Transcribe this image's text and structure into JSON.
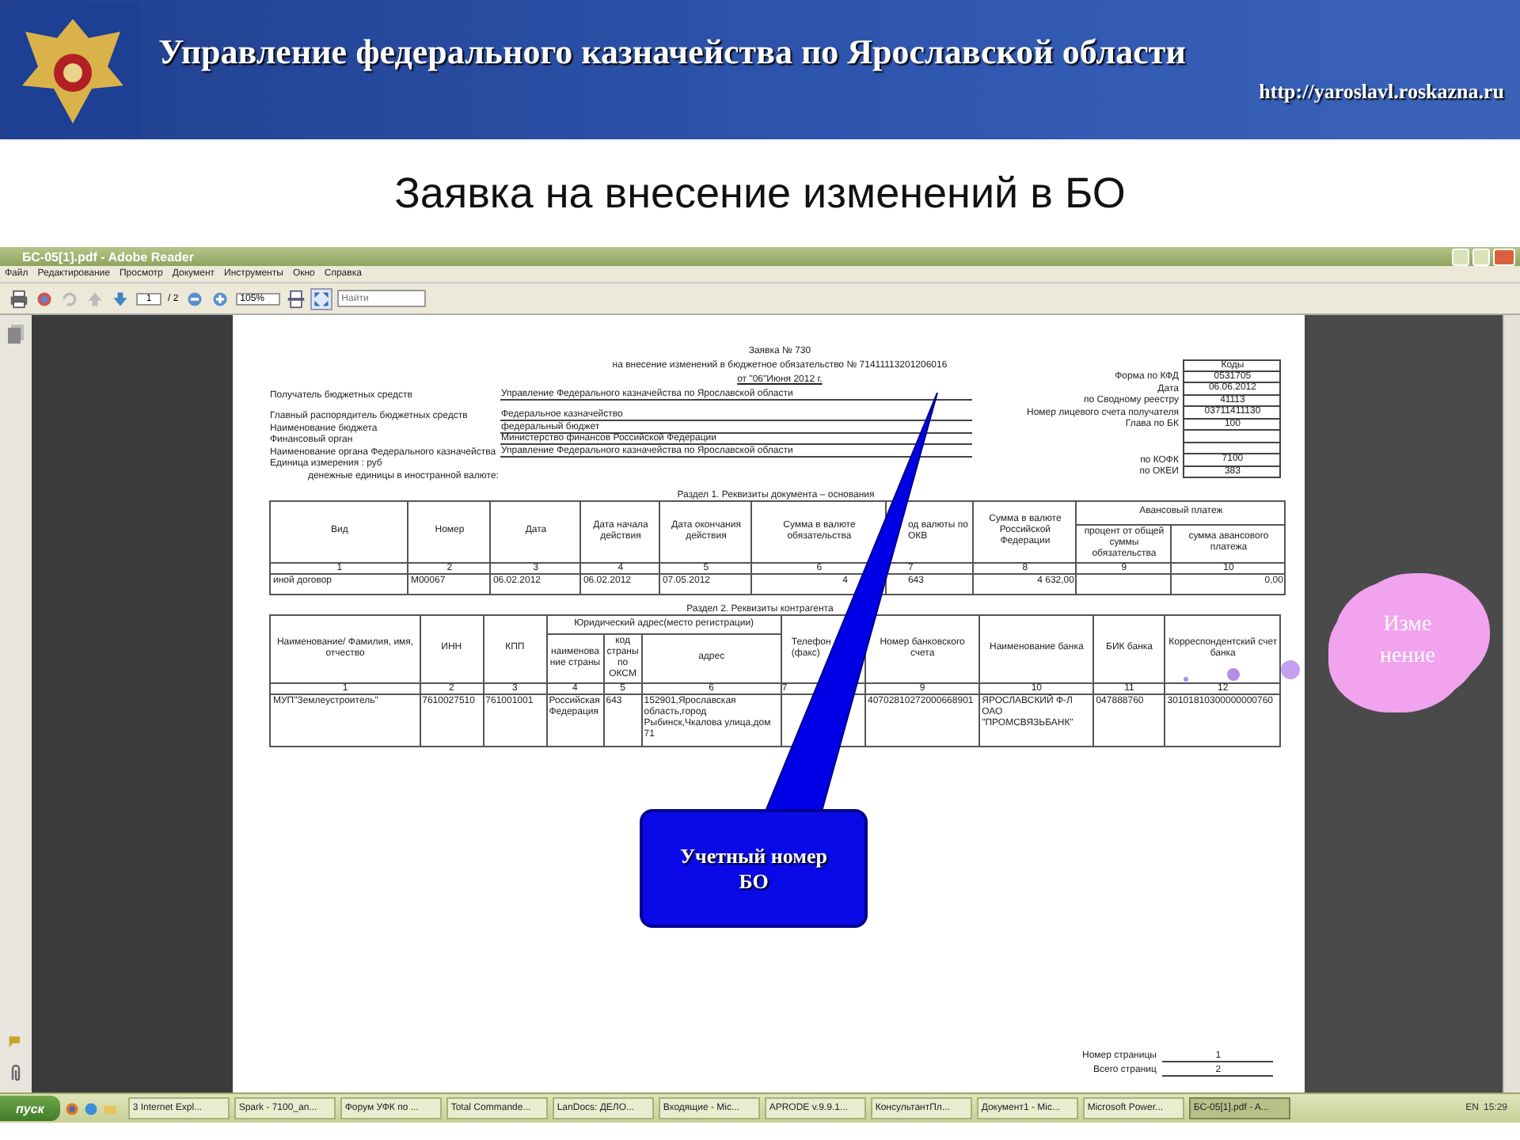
{
  "header": {
    "title": "Управление федерального казначейства по Ярославской области",
    "url": "http://yaroslavl.roskazna.ru"
  },
  "slide_title": "Заявка на внесение изменений в БО",
  "window": {
    "title": "БС-05[1].pdf - Adobe Reader",
    "menu": [
      "Файл",
      "Редактирование",
      "Просмотр",
      "Документ",
      "Инструменты",
      "Окно",
      "Справка"
    ],
    "toolbar": {
      "page": "1",
      "pages": "/ 2",
      "zoom": "105%",
      "search_placeholder": "Найти"
    }
  },
  "document": {
    "heading": [
      "Заявка     № 730",
      "на внесение изменений в бюджетное обязательство № 71411113201206016",
      "от \"06\"Июня 2012 г."
    ],
    "fields": [
      {
        "label": "Получатель бюджетных средств",
        "value": "Управление Федерального казначейства по Ярославской области"
      },
      {
        "label": "Главный распорядитель бюджетных средств",
        "value": "Федеральное казначейство"
      },
      {
        "label": "Наименование бюджета",
        "value": "федеральный бюджет"
      },
      {
        "label": "Финансовый орган",
        "value": "Министерство финансов Российской Федерации"
      },
      {
        "label": "Наименование органа Федерального казначейства",
        "value": "Управление Федерального казначейства по Ярославской области"
      },
      {
        "label": "Единица измерения : руб"
      },
      {
        "label": "денежные единицы в иностранной валюте:"
      }
    ],
    "codes_title": "Коды",
    "codes": [
      {
        "label": "Форма по КФД",
        "value": "0531705"
      },
      {
        "label": "Дата",
        "value": "06.06.2012"
      },
      {
        "label": "по Сводному реестру",
        "value": "41113"
      },
      {
        "label": "Номер лицевого счета получателя",
        "value": "03711411130"
      },
      {
        "label": "Глава по БК",
        "value": "100"
      }
    ],
    "codes_lower": [
      {
        "label": "по КОФК",
        "value": "7100"
      },
      {
        "label": "по ОКЕИ",
        "value": "383"
      }
    ],
    "sections": [
      {
        "title": "Раздел 1. Реквизиты документа – основания",
        "header_rows": [
          [
            {
              "label": "Вид",
              "rowspan": 2
            },
            {
              "label": "Номер",
              "rowspan": 2
            },
            {
              "label": "Дата",
              "rowspan": 2
            },
            {
              "label": "Дата начала действия",
              "rowspan": 2
            },
            {
              "label": "Дата окончания действия",
              "rowspan": 2
            },
            {
              "label": "Сумма в валюте обязательства",
              "rowspan": 2
            },
            {
              "label": "од валюты по ОКВ",
              "rowspan": 2
            },
            {
              "label": "Сумма в валюте Российской Федерации",
              "rowspan": 2
            },
            {
              "label": "Авансовый платеж",
              "colspan": 2
            }
          ],
          [
            {
              "label": "процент от общей суммы обязательства"
            },
            {
              "label": "сумма авансового платежа"
            }
          ]
        ],
        "numbers": [
          "1",
          "2",
          "3",
          "4",
          "5",
          "6",
          "7",
          "8",
          "9",
          "10"
        ],
        "rows": [
          [
            "иной договор",
            "М00067",
            "06.02.2012",
            "06.02.2012",
            "07.05.2012",
            "4",
            "643",
            "4 632,00",
            "",
            "0,00"
          ]
        ]
      },
      {
        "title": "Раздел 2. Реквизиты контрагента",
        "header_rows": [
          [
            {
              "label": "Наименование/ Фамилия, имя, отчество",
              "rowspan": 2
            },
            {
              "label": "ИНН",
              "rowspan": 2
            },
            {
              "label": "КПП",
              "rowspan": 2
            },
            {
              "label": "Юридический адрес(место регистрации)",
              "colspan": 3
            },
            {
              "label": "Телефон (факс)",
              "rowspan": 2
            },
            {
              "label": "Номер банковского счета",
              "rowspan": 2
            },
            {
              "label": "Наименование банка",
              "rowspan": 2
            },
            {
              "label": "БИК банка",
              "rowspan": 2
            },
            {
              "label": "Корреспондентский счет банка",
              "rowspan": 2
            }
          ],
          [
            {
              "label": "наименование страны"
            },
            {
              "label": "код страны по ОКСМ"
            },
            {
              "label": "адрес"
            }
          ]
        ],
        "numbers": [
          "1",
          "2",
          "3",
          "4",
          "5",
          "6",
          "7",
          "9",
          "10",
          "11",
          "12"
        ],
        "rows": [
          [
            "МУП\"Землеустроитель\"",
            "7610027510",
            "761001001",
            "Российская Федерация",
            "643",
            "152901,Ярославская область,город Рыбинск,Чкалова улица,дом 71",
            "",
            "40702810272000668901",
            "ЯРОСЛАВСКИЙ Ф-Л ОАО \"ПРОМСВЯЗЬБАНК\"",
            "047888760",
            "30101810300000000760"
          ]
        ]
      }
    ],
    "footer": [
      {
        "label": "Номер страницы",
        "value": "1"
      },
      {
        "label": "Всего страниц",
        "value": "2"
      }
    ]
  },
  "callout": "Учетный номер БО",
  "cloud": [
    "Изме",
    "нение"
  ],
  "taskbar": {
    "start": "пуск",
    "tasks": [
      {
        "label": "3 Internet Expl...",
        "selected": false
      },
      {
        "label": "Spark - 7100_an...",
        "selected": false
      },
      {
        "label": "Форум УФК по ...",
        "selected": false
      },
      {
        "label": "Total Commande...",
        "selected": false
      },
      {
        "label": "LanDocs: ДЕЛО...",
        "selected": false
      },
      {
        "label": "Входящие - Mic...",
        "selected": false
      },
      {
        "label": "APRODE v.9.9.1...",
        "selected": false
      },
      {
        "label": "КонсультантПл...",
        "selected": false
      },
      {
        "label": "Документ1 - Mic...",
        "selected": false
      },
      {
        "label": "Microsoft Power...",
        "selected": false
      },
      {
        "label": "БС-05[1].pdf - A...",
        "selected": true
      }
    ],
    "language": "EN",
    "clock": "15:29"
  }
}
